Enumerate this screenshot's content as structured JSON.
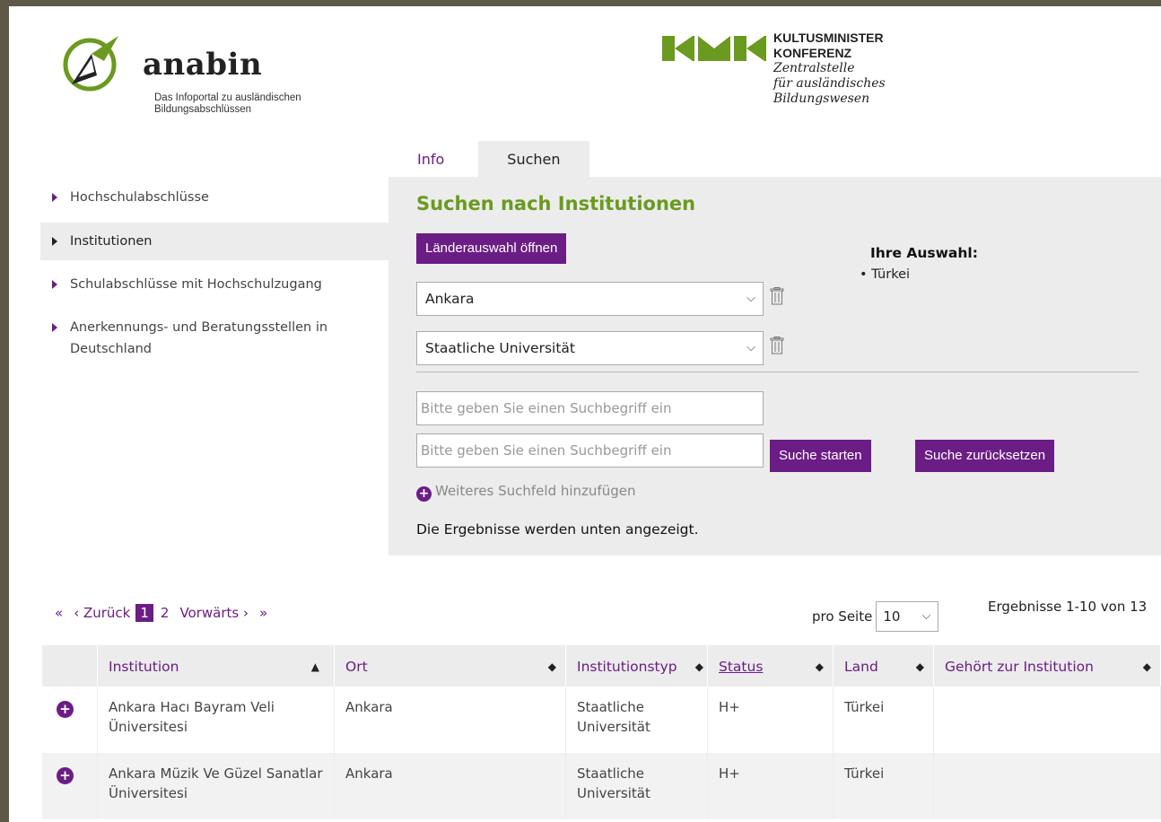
{
  "header": {
    "logo_title": "anabin",
    "logo_subtitle_line1": "Das Infoportal zu ausländischen",
    "logo_subtitle_line2": "Bildungsabschlüssen",
    "kmk_line1": "KULTUSMINISTER",
    "kmk_line2": "KONFERENZ",
    "kmk_line3": "Zentralstelle",
    "kmk_line4": "für ausländisches",
    "kmk_line5": "Bildungswesen",
    "colors": {
      "accent": "#6b1d85",
      "green": "#6a9a1f"
    }
  },
  "tabs": [
    {
      "label": "Info"
    },
    {
      "label": "Suchen"
    }
  ],
  "sidebar": {
    "items": [
      {
        "label": "Hochschulabschlüsse"
      },
      {
        "label": "Institutionen"
      },
      {
        "label": "Schulabschlüsse mit Hochschulzugang"
      },
      {
        "label": "Anerkennungs- und Beratungsstellen in Deutschland"
      }
    ]
  },
  "search": {
    "title": "Suchen nach Institutionen",
    "laender_button": "Länderauswahl öffnen",
    "city_select": "Ankara",
    "type_select": "Staatliche Universität",
    "selection_title": "Ihre Auswahl:",
    "selection_item": "Türkei",
    "placeholder": "Bitte geben Sie einen Suchbegriff ein",
    "start_button": "Suche starten",
    "reset_button": "Suche zurücksetzen",
    "add_field": "Weiteres Suchfeld hinzufügen",
    "results_note": "Die Ergebnisse werden unten angezeigt."
  },
  "pager": {
    "first": "«",
    "prev": "‹ Zurück",
    "current": "1",
    "page2": "2",
    "next": "Vorwärts ›",
    "last": "»",
    "per_page_label": "pro Seite",
    "per_page_value": "10",
    "count": "Ergebnisse 1-10 von 13"
  },
  "table": {
    "headers": [
      "Institution",
      "Ort",
      "Institutionstyp",
      "Status",
      "Land",
      "Gehört zur Institution"
    ],
    "rows": [
      {
        "institution": "Ankara Hacı Bayram Veli Üniversitesi",
        "ort": "Ankara",
        "typ": "Staatliche Universität",
        "status": "H+",
        "land": "Türkei",
        "gehoert": ""
      },
      {
        "institution": "Ankara Müzik Ve Güzel Sanatlar Üniversitesi",
        "ort": "Ankara",
        "typ": "Staatliche Universität",
        "status": "H+",
        "land": "Türkei",
        "gehoert": ""
      }
    ]
  }
}
